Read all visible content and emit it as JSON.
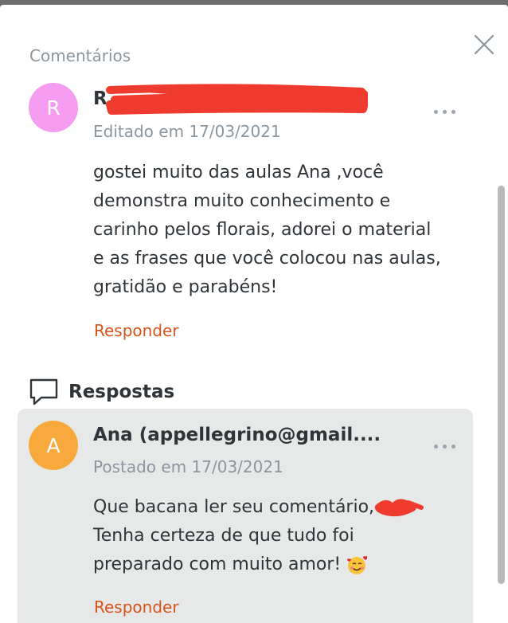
{
  "header": {
    "title": "Comentários"
  },
  "comment": {
    "avatar_initial": "R",
    "author_visible": "R",
    "meta": "Editado em 17/03/2021",
    "body_lines": [
      "gostei muito das aulas Ana ,você",
      "demonstra muito conhecimento e",
      "carinho pelos florais, adorei o material",
      "e as frases que você colocou nas aulas,",
      "gratidão e parabéns!"
    ],
    "reply_label": "Responder"
  },
  "replies": {
    "label": "Respostas",
    "items": [
      {
        "avatar_initial": "A",
        "author": "Ana (appellegrino@gmail....",
        "meta": "Postado em 17/03/2021",
        "body_lines": [
          "Que bacana ler seu comentário,",
          "Tenha certeza de que tudo foi",
          "preparado com muito amor! "
        ],
        "emoji": "🥰",
        "reply_label": "Responder"
      }
    ]
  },
  "colors": {
    "accent_link": "#d4541a",
    "avatar_r": "#f49cf0",
    "avatar_a": "#f7a93b",
    "redaction": "#ee3b2e"
  },
  "icons": [
    "close-icon",
    "more-options-icon",
    "speech-bubble-icon",
    "smiling-face-with-hearts-emoji"
  ]
}
